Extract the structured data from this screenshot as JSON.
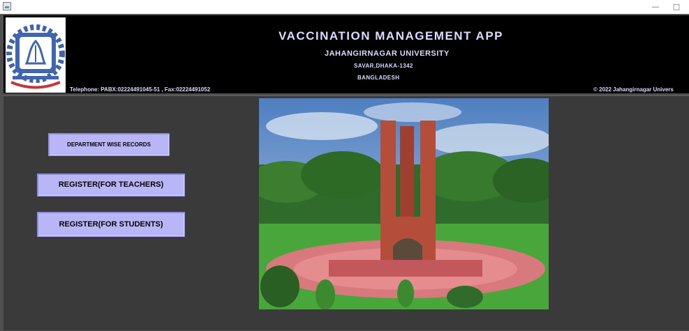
{
  "window": {
    "minimize_glyph": "—",
    "maximize_glyph": "□"
  },
  "header": {
    "title": "VACCINATION  MANAGEMENT  APP",
    "university": "JAHANGIRNAGAR UNIVERSITY",
    "address": "SAVAR,DHAKA-1342",
    "country": "BANGLADESH",
    "telephone": "Telephone: PABX:02224491045-51 , Fax:02224491052",
    "copyright": "© 2022 Jahangirnagar Univers"
  },
  "buttons": {
    "department_records": "DEPARTMENT WISE RECORDS",
    "register_teachers": "REGISTER(FOR TEACHERS)",
    "register_students": "REGISTER(FOR STUDENTS)"
  },
  "colors": {
    "header_bg": "#000000",
    "body_bg": "#3a3a3a",
    "button_bg": "#b9b6f7",
    "header_text": "#dcdcff"
  }
}
